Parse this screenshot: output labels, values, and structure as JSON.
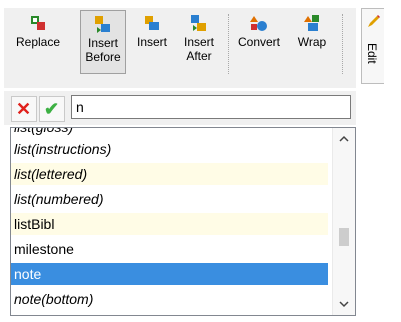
{
  "toolbar": {
    "buttons": [
      {
        "label": "Replace"
      },
      {
        "label": "Insert Before"
      },
      {
        "label": "Insert"
      },
      {
        "label": "Insert After"
      },
      {
        "label": "Convert"
      },
      {
        "label": "Wrap"
      }
    ],
    "edit_tab": "Edit"
  },
  "filter": {
    "value": "n",
    "clear": "✕",
    "accept": "✔"
  },
  "list": {
    "partial_item": "list(gloss)",
    "items": [
      {
        "text": "list(instructions)",
        "italic": true,
        "alt": false,
        "selected": false
      },
      {
        "text": "list(lettered)",
        "italic": true,
        "alt": true,
        "selected": false
      },
      {
        "text": "list(numbered)",
        "italic": true,
        "alt": false,
        "selected": false
      },
      {
        "text": "listBibl",
        "italic": false,
        "alt": true,
        "selected": false
      },
      {
        "text": "milestone",
        "italic": false,
        "alt": false,
        "selected": false
      },
      {
        "text": "note",
        "italic": false,
        "alt": false,
        "selected": true
      },
      {
        "text": "note(bottom)",
        "italic": true,
        "alt": false,
        "selected": false
      }
    ],
    "scroll_position": 0.62
  },
  "colors": {
    "selection": "#3a8ee0",
    "alt_row": "#fffce6",
    "clear_icon": "#e0201b",
    "accept_icon": "#3cb043"
  },
  "icons": [
    "replace-icon",
    "insert-before-icon",
    "insert-icon",
    "insert-after-icon",
    "convert-icon",
    "wrap-icon",
    "edit-pencil-icon"
  ]
}
